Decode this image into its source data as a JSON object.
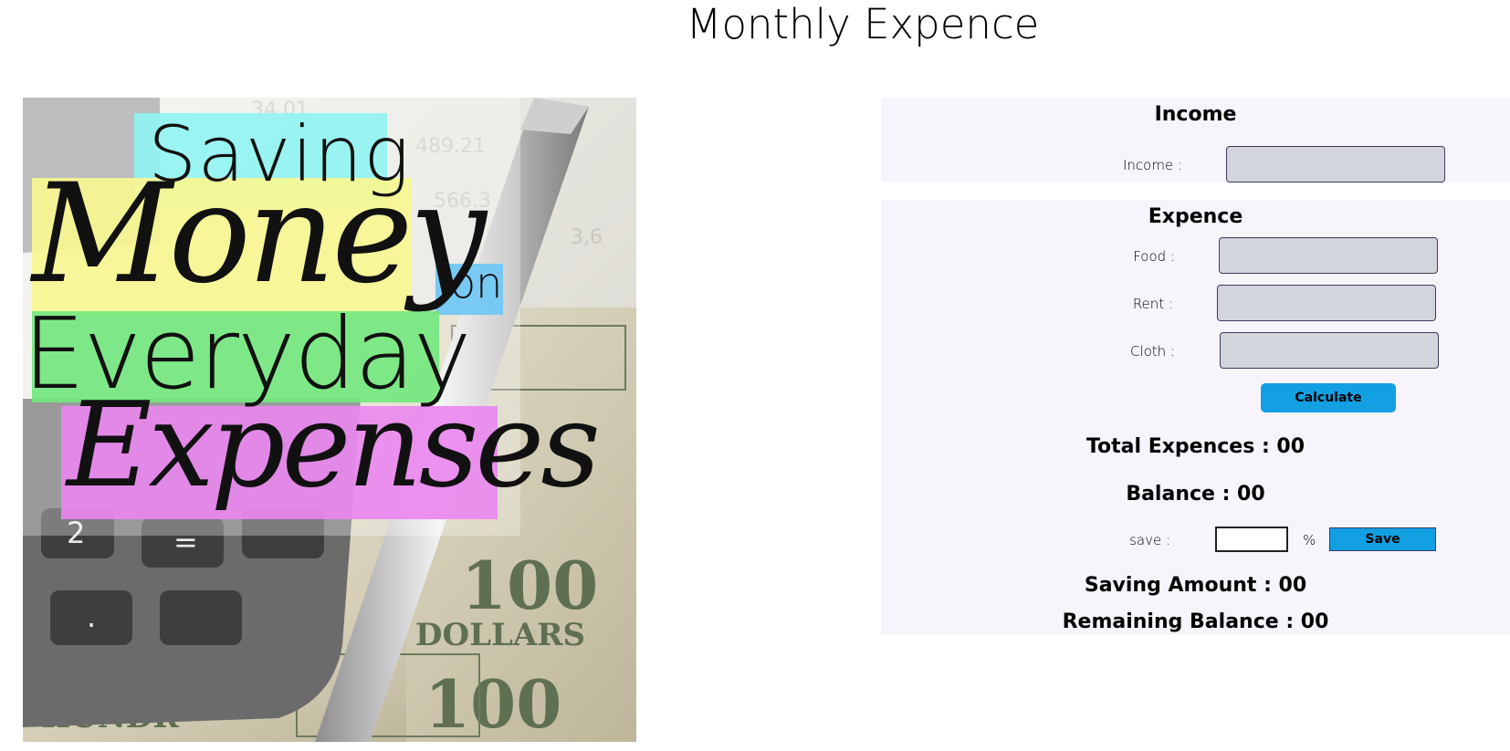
{
  "page": {
    "title": "Monthly Expence"
  },
  "hero": {
    "line1": "Saving",
    "line2": "Money",
    "line3": "on",
    "line4": "Everyday",
    "line5": "Expenses"
  },
  "income": {
    "heading": "Income",
    "label": "Income :",
    "value": ""
  },
  "expence": {
    "heading": "Expence",
    "fields": [
      {
        "label": "Food :",
        "value": ""
      },
      {
        "label": "Rent :",
        "value": ""
      },
      {
        "label": "Cloth :",
        "value": ""
      }
    ],
    "calculate_label": "Calculate",
    "total_expences": "Total Expences : 00",
    "balance": "Balance : 00",
    "save": {
      "label": "save :",
      "value": "",
      "percent_symbol": "%",
      "button_label": "Save"
    },
    "saving_amount": "Saving Amount : 00",
    "remaining_balance": "Remaining Balance : 00"
  },
  "colors": {
    "button_blue": "#12a0e3",
    "panel_bg": "#f8f4fc",
    "input_bg": "#d3d5dc"
  }
}
